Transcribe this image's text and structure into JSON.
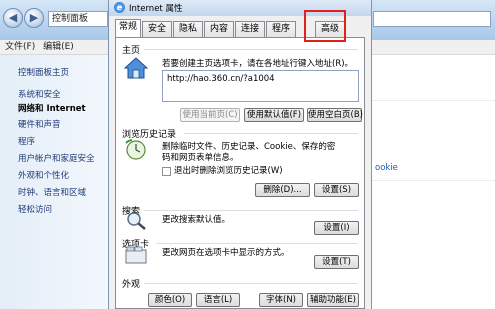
{
  "control_panel": {
    "address_text": "控制面板",
    "menu": [
      "文件(F)",
      "编辑(E)"
    ],
    "sidebar": [
      {
        "label": "控制面板主页",
        "bold": false
      },
      {
        "label": "系统和安全",
        "bold": false
      },
      {
        "label": "网络和 Internet",
        "bold": true
      },
      {
        "label": "硬件和声音",
        "bold": false
      },
      {
        "label": "程序",
        "bold": false
      },
      {
        "label": "用户帐户和家庭安全",
        "bold": false
      },
      {
        "label": "外观和个性化",
        "bold": false
      },
      {
        "label": "时钟、语言和区域",
        "bold": false
      },
      {
        "label": "轻松访问",
        "bold": false
      }
    ],
    "right_partial_text": "ookie"
  },
  "dialog": {
    "title": "Internet 属性",
    "tabs": [
      "常规",
      "安全",
      "隐私",
      "内容",
      "连接",
      "程序",
      "高级"
    ],
    "active_tab": "常规",
    "highlighted_tab": "高级",
    "home": {
      "title": "主页",
      "description": "若要创建主页选项卡，请在各地址行键入地址(R)。",
      "url": "http://hao.360.cn/?a1004",
      "buttons": [
        "使用当前页(C)",
        "使用默认值(F)",
        "使用空白页(B)"
      ]
    },
    "history": {
      "title": "浏览历史记录",
      "description": "删除临时文件、历史记录、Cookie、保存的密码和网页表单信息。",
      "checkbox_label": "退出时删除浏览历史记录(W)",
      "buttons": [
        "删除(D)...",
        "设置(S)"
      ]
    },
    "search": {
      "title": "搜索",
      "description": "更改搜索默认值。",
      "button": "设置(I)"
    },
    "tabs_section": {
      "title": "选项卡",
      "description": "更改网页在选项卡中显示的方式。",
      "button": "设置(T)"
    },
    "appearance": {
      "title": "外观",
      "buttons": [
        "颜色(O)",
        "语言(L)",
        "字体(N)",
        "辅助功能(E)"
      ]
    }
  },
  "colors": {
    "highlight": "#e32020",
    "link": "#1e3a78"
  }
}
